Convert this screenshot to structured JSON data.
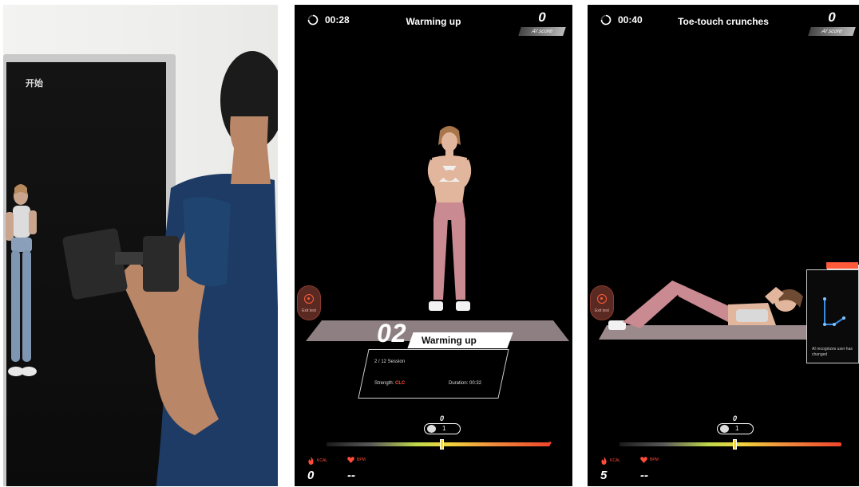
{
  "photo": {
    "mirror_text": "开始"
  },
  "warmup_screen": {
    "timer": "00:28",
    "title": "Warming up",
    "score": "0",
    "score_label": "AI score",
    "side_button_label": "Exit test",
    "card": {
      "number": "02",
      "title": "Warming up",
      "session": "2 / 12 Session",
      "strength_label": "Strength:",
      "strength_value": "CLC",
      "duration": "Duration: 00:32"
    },
    "rep_count": "0",
    "pill_value": "1",
    "kcal_label": "KCAL",
    "bpm_label": "BPM",
    "kcal_value": "0",
    "bpm_value": "--"
  },
  "crunch_screen": {
    "timer": "00:40",
    "title": "Toe-touch crunches",
    "score": "0",
    "score_label": "AI score",
    "side_button_label": "Exit test",
    "ai_message": "AI recognizes user has changed",
    "rep_count": "0",
    "pill_value": "1",
    "kcal_label": "KCAL",
    "bpm_label": "BPM",
    "kcal_value": "5",
    "bpm_value": "--"
  },
  "colors": {
    "accent_red": "#ff4b3a",
    "gauge_yellow": "#f0d53c"
  }
}
